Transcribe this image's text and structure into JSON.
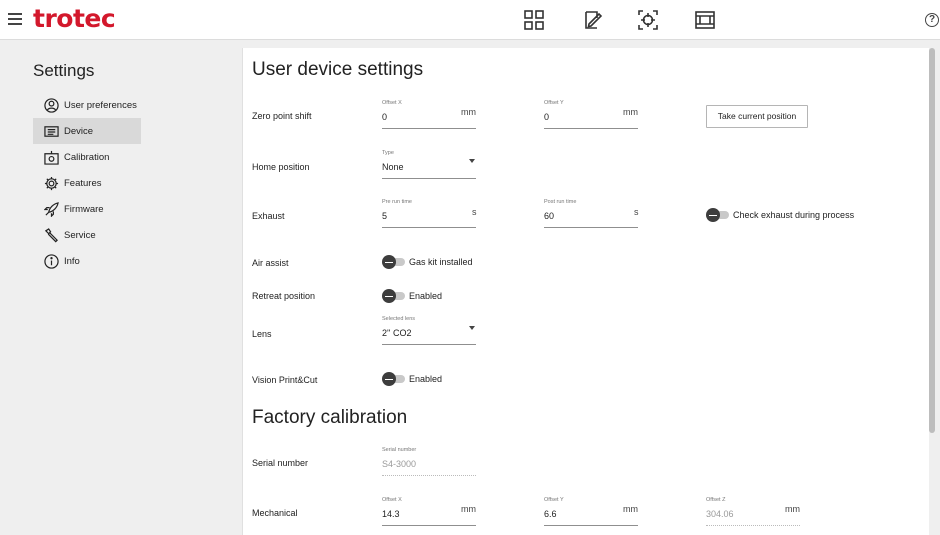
{
  "app": {
    "logo_text": "trotec",
    "brand_color": "#d3182c",
    "top_icons": [
      "grid-icon",
      "edit-document-icon",
      "crosshair-icon",
      "film-frame-icon"
    ],
    "help_label": "?"
  },
  "sidebar": {
    "title": "Settings",
    "items": [
      {
        "label": "User preferences",
        "icon": "user-circle-icon",
        "active": false
      },
      {
        "label": "Device",
        "icon": "device-icon",
        "active": true
      },
      {
        "label": "Calibration",
        "icon": "calibration-icon",
        "active": false
      },
      {
        "label": "Features",
        "icon": "gear-icon",
        "active": false
      },
      {
        "label": "Firmware",
        "icon": "rocket-icon",
        "active": false
      },
      {
        "label": "Service",
        "icon": "wrench-icon",
        "active": false
      },
      {
        "label": "Info",
        "icon": "info-icon",
        "active": false
      }
    ]
  },
  "user_device": {
    "title": "User device settings",
    "zero_point": {
      "label": "Zero point shift",
      "offset_x": {
        "label": "Offset X",
        "value": "0",
        "unit": "mm"
      },
      "offset_y": {
        "label": "Offset Y",
        "value": "0",
        "unit": "mm"
      },
      "button": "Take current position"
    },
    "home_position": {
      "label": "Home position",
      "type_label": "Type",
      "type_value": "None"
    },
    "exhaust": {
      "label": "Exhaust",
      "pre_run": {
        "label": "Pre run time",
        "value": "5",
        "unit": "s"
      },
      "post_run": {
        "label": "Post run time",
        "value": "60",
        "unit": "s"
      },
      "check_toggle": "Check exhaust during process"
    },
    "air_assist": {
      "label": "Air assist",
      "toggle": "Gas kit installed"
    },
    "retreat": {
      "label": "Retreat position",
      "toggle": "Enabled"
    },
    "lens": {
      "label": "Lens",
      "sel_label": "Selected lens",
      "sel_value": "2'' CO2"
    },
    "vision": {
      "label": "Vision Print&Cut",
      "toggle": "Enabled"
    }
  },
  "factory": {
    "title": "Factory calibration",
    "serial": {
      "label": "Serial number",
      "field_label": "Serial number",
      "value": "S4-3000"
    },
    "mechanical": {
      "label": "Mechanical",
      "offset_x": {
        "label": "Offset X",
        "value": "14.3",
        "unit": "mm"
      },
      "offset_y": {
        "label": "Offset Y",
        "value": "6.6",
        "unit": "mm"
      },
      "offset_z": {
        "label": "Offset Z",
        "value": "304.06",
        "unit": "mm"
      }
    }
  }
}
